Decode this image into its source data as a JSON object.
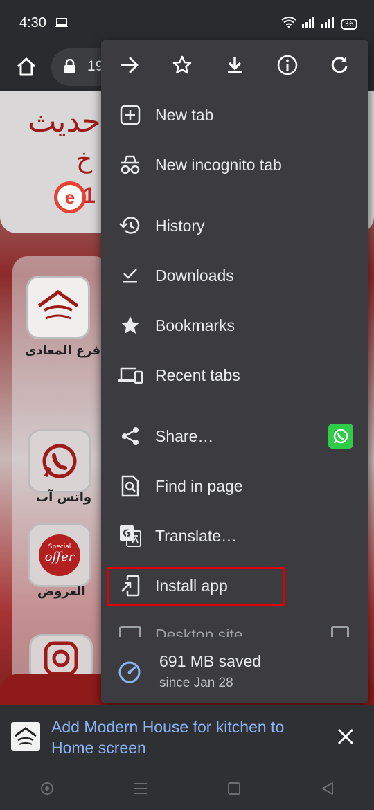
{
  "status_bar": {
    "time": "4:30",
    "battery": "36"
  },
  "browser": {
    "url_partial": "19"
  },
  "website": {
    "banner_ar_top": "حديث",
    "banner_ar_bottom": "خ",
    "logo_letter": "e",
    "logo_tail": "1",
    "side_items": [
      {
        "label": "فرع المعادى"
      },
      {
        "label": "واتس آب"
      },
      {
        "label": "العروض"
      }
    ],
    "offer_text": "offer",
    "offer_small": "Special"
  },
  "menu": {
    "top_actions": [
      {
        "icon": "forward-arrow-icon"
      },
      {
        "icon": "star-icon"
      },
      {
        "icon": "download-icon"
      },
      {
        "icon": "info-icon"
      },
      {
        "icon": "refresh-icon"
      }
    ],
    "items": {
      "new_tab": "New tab",
      "new_incognito_tab": "New incognito tab",
      "history": "History",
      "downloads": "Downloads",
      "bookmarks": "Bookmarks",
      "recent_tabs": "Recent tabs",
      "share": "Share…",
      "find_in_page": "Find in page",
      "translate": "Translate…",
      "install_app": "Install app",
      "desktop_site": "Desktop site"
    },
    "data_saved": {
      "amount": "691 MB saved",
      "since": "since Jan 28"
    }
  },
  "add_to_home": {
    "text": "Add Modern House for kitchen to Home screen"
  },
  "colors": {
    "menu_bg": "#3c3c40",
    "highlight": "#e00000",
    "link_blue": "#8ab4f8",
    "whatsapp_green": "#2ecc49"
  }
}
